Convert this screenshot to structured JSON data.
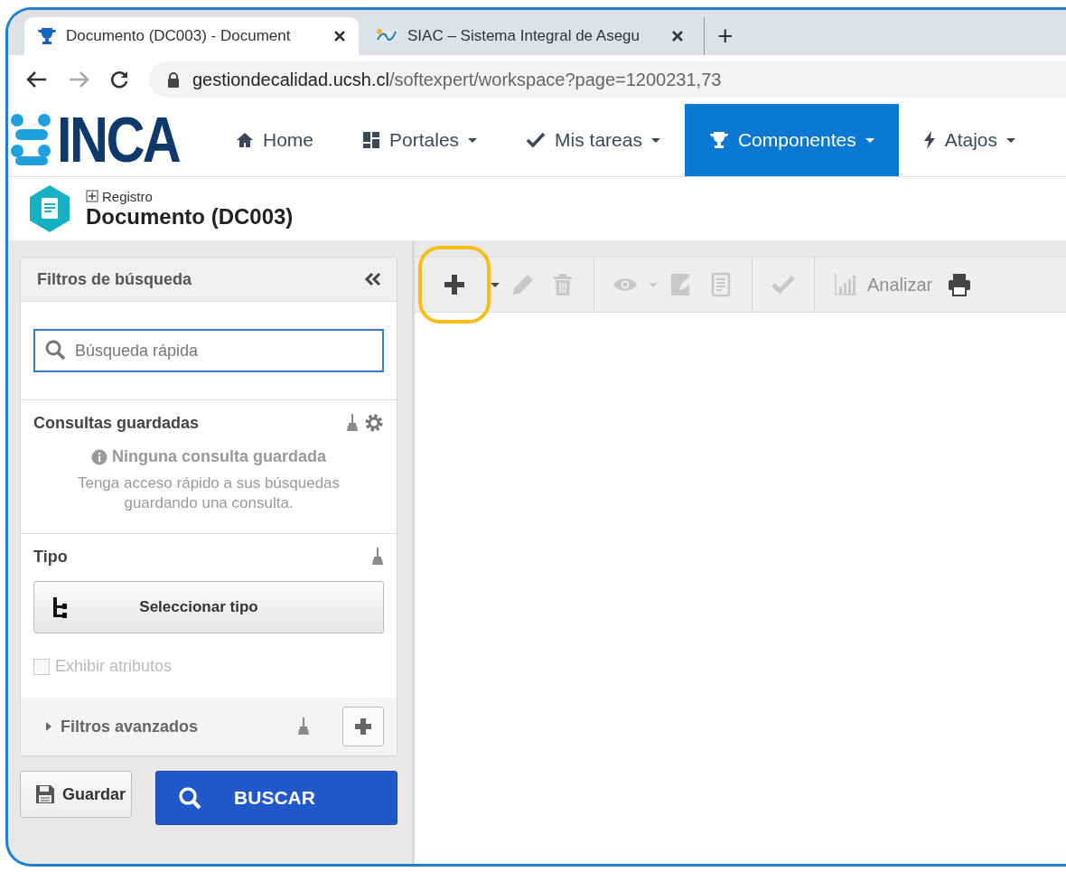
{
  "browser": {
    "tabs": [
      {
        "title": "Documento (DC003) - Document",
        "selected": true,
        "kind": "trophy"
      },
      {
        "title": "SIAC – Sistema Integral de Asegu",
        "selected": false,
        "kind": "siac"
      }
    ],
    "new_tab": "+",
    "address": {
      "host": "gestiondecalidad.ucsh.cl",
      "path": "/softexpert/workspace?page=1200231,73"
    }
  },
  "app": {
    "logo": "INCA",
    "nav": [
      {
        "label": "Home",
        "kind": "home",
        "dropdown": false,
        "selected": false
      },
      {
        "label": "Portales",
        "kind": "grid",
        "dropdown": true,
        "selected": false
      },
      {
        "label": "Mis tareas",
        "kind": "check",
        "dropdown": true,
        "selected": false
      },
      {
        "label": "Componentes",
        "kind": "trophy",
        "dropdown": true,
        "selected": true
      },
      {
        "label": "Atajos",
        "kind": "bolt",
        "dropdown": true,
        "selected": false
      }
    ]
  },
  "header": {
    "badge": "Registro",
    "title": "Documento (DC003)"
  },
  "filters": {
    "title": "Filtros de búsqueda",
    "search": {
      "placeholder": "Búsqueda rápida"
    },
    "saved": {
      "title": "Consultas guardadas",
      "empty_title": "Ninguna consulta guardada",
      "empty_text": "Tenga acceso rápido a sus búsquedas guardando una consulta."
    },
    "type": {
      "title": "Tipo",
      "button": "Seleccionar tipo",
      "checkbox": {
        "label": "Exhibir atributos",
        "checked": false,
        "disabled": true
      }
    },
    "advanced": {
      "label": "Filtros avanzados",
      "expanded": false
    },
    "save_button": "Guardar",
    "search_button": "BUSCAR"
  },
  "toolbar": [
    {
      "kind": "plus",
      "disabled": false,
      "highlighted": true
    },
    {
      "kind": "caret",
      "disabled": false,
      "highlighted": false
    },
    {
      "kind": "pencil",
      "disabled": true,
      "highlighted": false
    },
    {
      "kind": "trash",
      "disabled": true,
      "highlighted": false
    },
    {
      "kind": "sep"
    },
    {
      "kind": "eye",
      "disabled": true,
      "highlighted": false
    },
    {
      "kind": "caret",
      "disabled": true,
      "highlighted": false
    },
    {
      "kind": "edit-doc",
      "disabled": true,
      "highlighted": false
    },
    {
      "kind": "doc",
      "disabled": true,
      "highlighted": false
    },
    {
      "kind": "sep"
    },
    {
      "kind": "check",
      "disabled": true,
      "highlighted": false
    },
    {
      "kind": "sep"
    },
    {
      "kind": "chart",
      "disabled": true,
      "highlighted": false,
      "label": "Analizar"
    },
    {
      "kind": "printer",
      "disabled": false,
      "highlighted": false
    }
  ]
}
